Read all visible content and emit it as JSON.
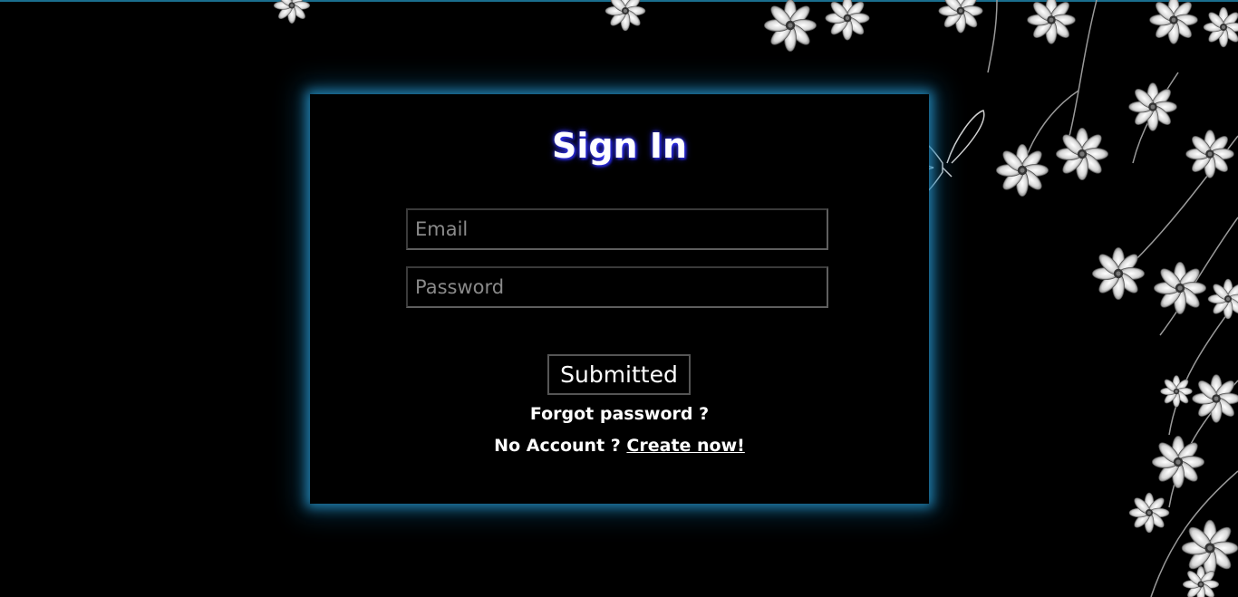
{
  "signin": {
    "title": "Sign In",
    "email_placeholder": "Email",
    "password_placeholder": "Password",
    "submit_label": "Submitted",
    "forgot_label": "Forgot password ?",
    "no_account_text": "No Account ?",
    "create_link_label": "Create now!"
  },
  "colors": {
    "background": "#000000",
    "card_glow": "#248cbe",
    "title_glow": "#3a3aff",
    "text": "#ffffff",
    "field_border": "#5e5e5e"
  },
  "decor": {
    "flowers_icon": "flower-icon",
    "butterfly_icon": "butterfly-icon"
  }
}
